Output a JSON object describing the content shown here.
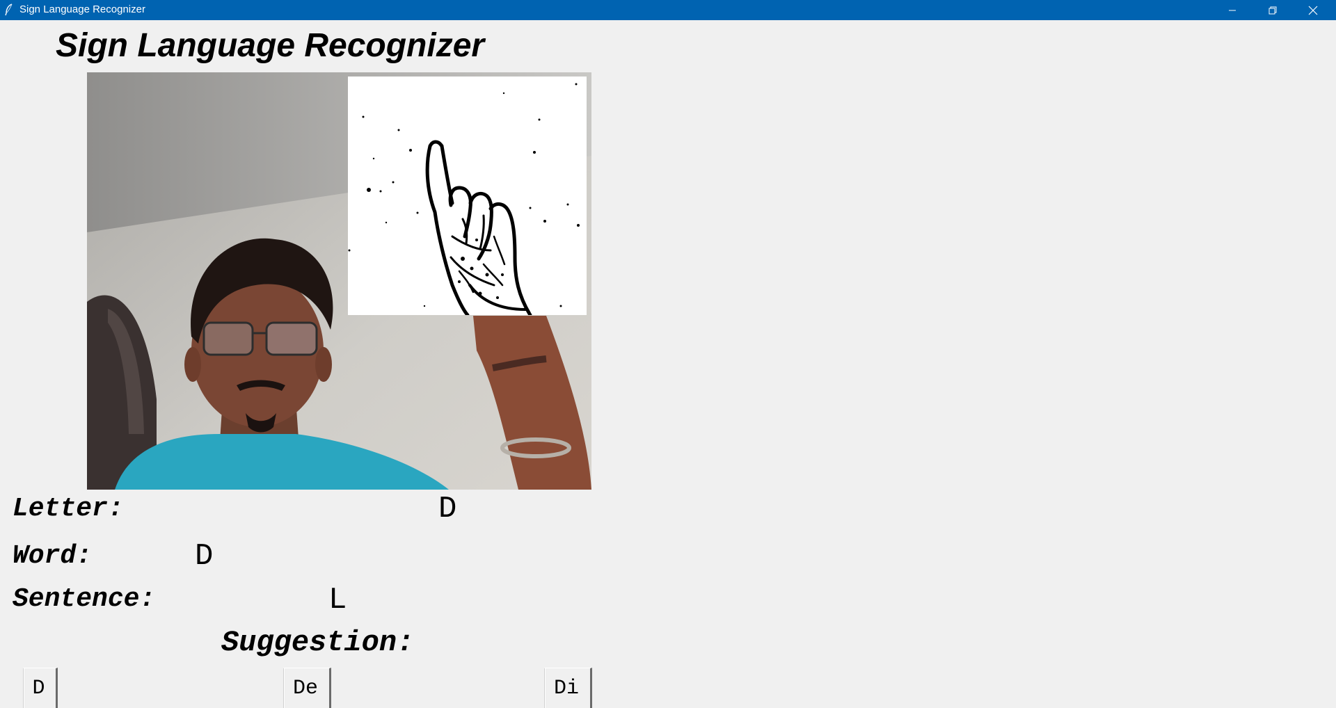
{
  "window": {
    "title": "Sign Language Recognizer",
    "titlebar_color": "#0063b1"
  },
  "app": {
    "heading": "Sign Language Recognizer"
  },
  "fields": {
    "letter_label": "Letter:",
    "letter_value": "D",
    "word_label": "Word:",
    "word_value": "D",
    "sentence_label": "Sentence:",
    "sentence_value": "L",
    "suggestion_label": "Suggestion:"
  },
  "suggestions": [
    "D",
    "De",
    "Di"
  ],
  "icons": {
    "app": "feather-icon",
    "minimize": "minimize-icon",
    "restore": "restore-icon",
    "close": "close-icon"
  }
}
